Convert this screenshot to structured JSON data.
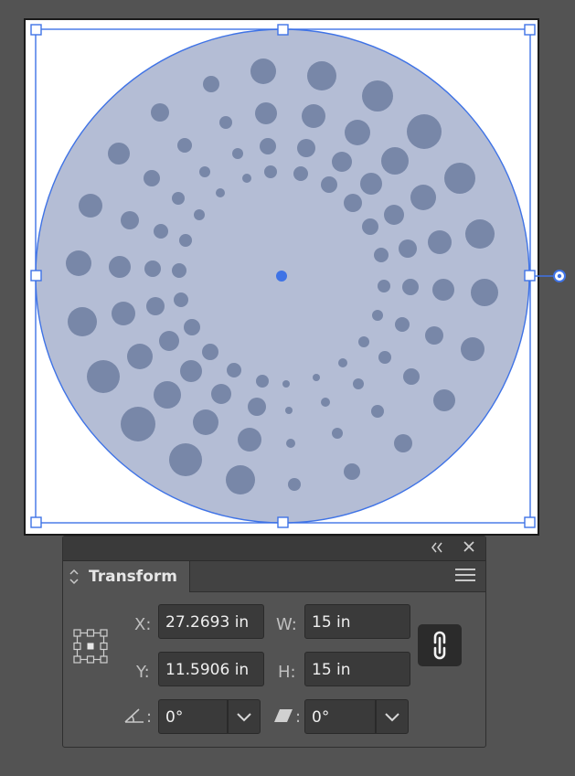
{
  "canvas": {
    "selection_color": "#3f73e6",
    "circle_fill": "#b4bdd5",
    "dot_fill": "#7887a8"
  },
  "panel": {
    "title": "Transform",
    "collapse_icon": "double-chevron-left-icon",
    "close_icon": "close-icon",
    "menu_icon": "hamburger-menu-icon",
    "reference_point_icon": "reference-point-grid-icon",
    "constrain_icon": "link-chain-icon",
    "rotate_icon": "angle-icon",
    "shear_icon": "shear-icon",
    "x": {
      "label": "X:",
      "value": "27.2693 in"
    },
    "y": {
      "label": "Y:",
      "value": "11.5906 in"
    },
    "w": {
      "label": "W:",
      "value": "15 in"
    },
    "h": {
      "label": "H:",
      "value": "15 in"
    },
    "rotate": {
      "label": ":",
      "value": "0°"
    },
    "shear": {
      "label": ":",
      "value": "0°"
    }
  }
}
